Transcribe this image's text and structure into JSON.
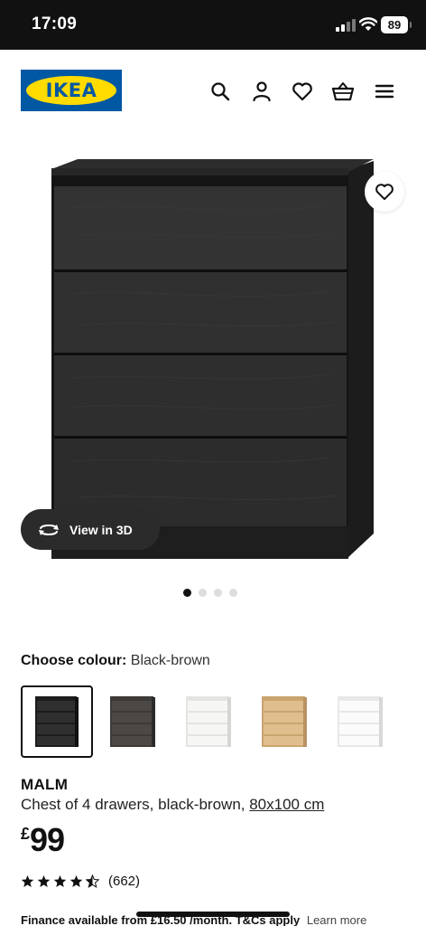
{
  "status_bar": {
    "time": "17:09",
    "battery": "89"
  },
  "header": {
    "logo_text": "IKEA"
  },
  "gallery": {
    "view_3d_label": "View in 3D",
    "image_count": 4,
    "active_index": 0
  },
  "colour": {
    "label": "Choose colour:",
    "value": "Black-brown",
    "swatches": [
      {
        "name": "Black-brown",
        "color": "#2a2a2a",
        "selected": true
      },
      {
        "name": "Dark grey",
        "color": "#4a4644",
        "selected": false
      },
      {
        "name": "White",
        "color": "#f3f3f1",
        "selected": false
      },
      {
        "name": "Oak veneer",
        "color": "#ddbd8e",
        "selected": false
      },
      {
        "name": "High-gloss white",
        "color": "#f7f7f7",
        "selected": false
      }
    ]
  },
  "product": {
    "name": "MALM",
    "description": "Chest of 4 drawers, black-brown, ",
    "size": "80x100 cm",
    "currency": "£",
    "price": "99",
    "rating": 4.5,
    "review_count": "(662)"
  },
  "finance": {
    "text": "Finance available from £16.50 /month. T&Cs apply",
    "link": "Learn more"
  },
  "colors": {
    "ikea_blue": "#0058a3",
    "ikea_yellow": "#ffdb00"
  }
}
